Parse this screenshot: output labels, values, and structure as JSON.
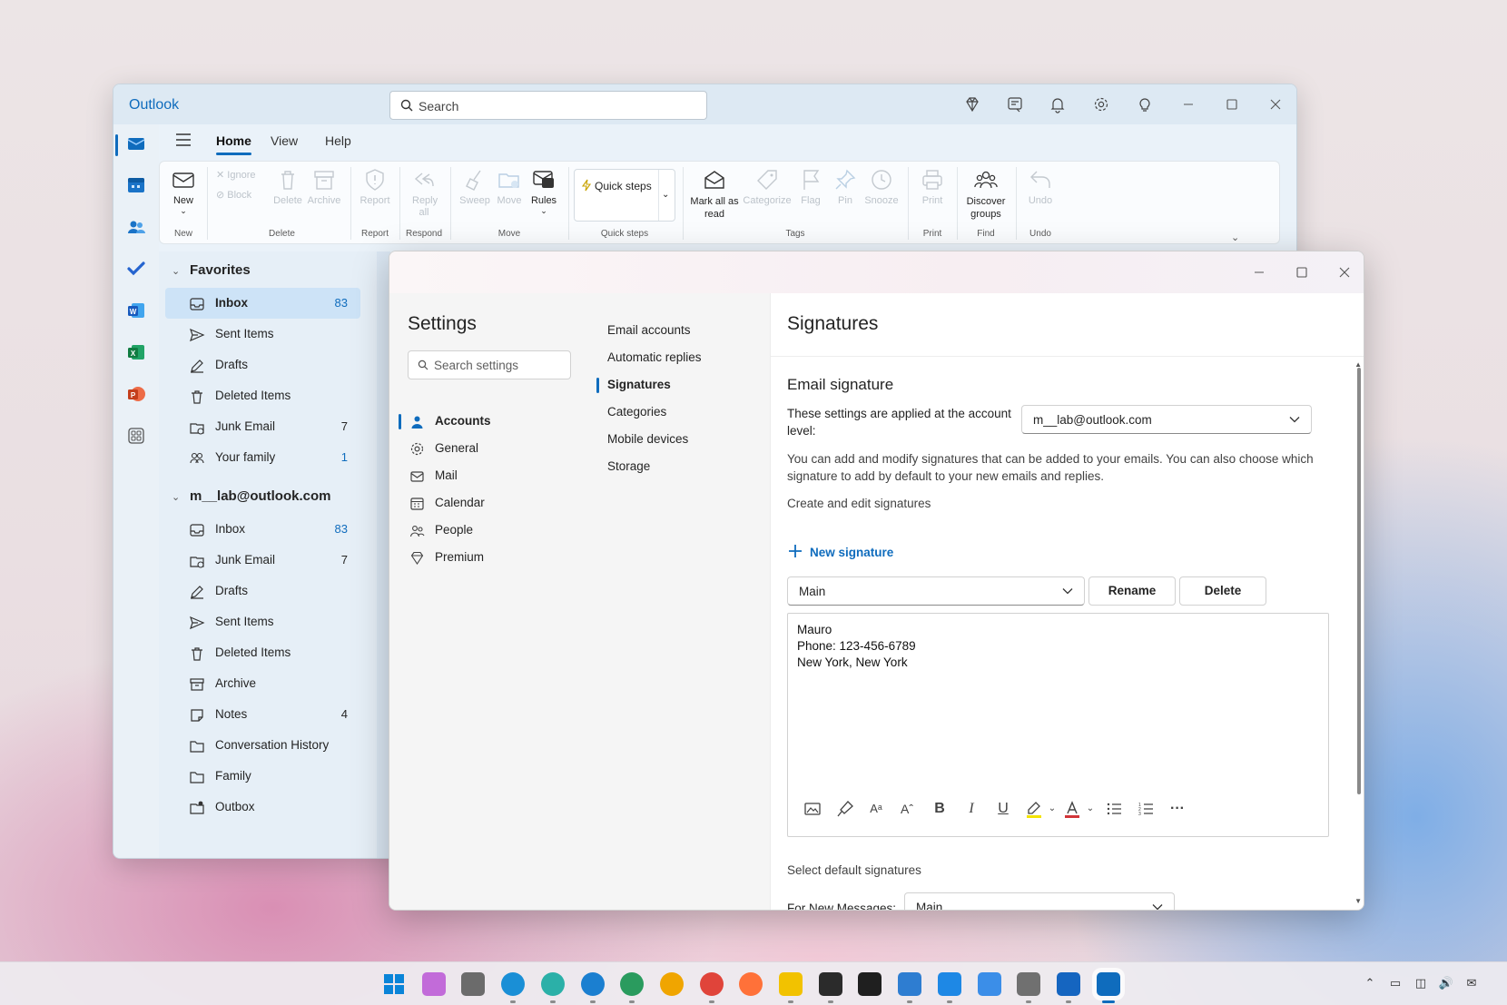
{
  "app": {
    "title": "Outlook",
    "search_placeholder": "Search",
    "accent": "#0f6cbd"
  },
  "titlebar_icons": [
    "diamond-icon",
    "notes-icon",
    "bell-icon",
    "gear-icon",
    "lightbulb-icon",
    "minimize-icon",
    "maximize-icon",
    "close-icon"
  ],
  "rail_icons": [
    "mail-icon",
    "calendar-icon",
    "people-icon",
    "todo-icon",
    "word-icon",
    "excel-icon",
    "powerpoint-icon",
    "apps-icon"
  ],
  "ribbon": {
    "tabs": [
      "Home",
      "View",
      "Help"
    ],
    "buttons": {
      "new": "New",
      "ignore": "Ignore",
      "block": "Block",
      "delete": "Delete",
      "archive": "Archive",
      "report": "Report",
      "reply_all": "Reply all",
      "sweep": "Sweep",
      "move": "Move",
      "rules": "Rules",
      "quick_steps": "Quick steps",
      "mark_all_read": "Mark all as read",
      "categorize": "Categorize",
      "flag": "Flag",
      "pin": "Pin",
      "snooze": "Snooze",
      "print": "Print",
      "discover_groups": "Discover groups",
      "undo": "Undo"
    },
    "groups": {
      "new": "New",
      "delete": "Delete",
      "report": "Report",
      "respond": "Respond",
      "move": "Move",
      "quick_steps": "Quick steps",
      "tags": "Tags",
      "print": "Print",
      "find": "Find",
      "undo": "Undo"
    }
  },
  "folders": {
    "favorites_label": "Favorites",
    "favorites": [
      {
        "name": "Inbox",
        "count": "83",
        "icon": "inbox-icon"
      },
      {
        "name": "Sent Items",
        "count": "",
        "icon": "send-icon"
      },
      {
        "name": "Drafts",
        "count": "",
        "icon": "drafts-icon"
      },
      {
        "name": "Deleted Items",
        "count": "",
        "icon": "trash-icon"
      },
      {
        "name": "Junk Email",
        "count": "7",
        "icon": "junk-icon"
      },
      {
        "name": "Your family",
        "count": "1",
        "icon": "family-icon"
      }
    ],
    "account_label": "m__lab@outlook.com",
    "account": [
      {
        "name": "Inbox",
        "count": "83",
        "icon": "inbox-icon"
      },
      {
        "name": "Junk Email",
        "count": "7",
        "icon": "junk-icon"
      },
      {
        "name": "Drafts",
        "count": "",
        "icon": "drafts-icon"
      },
      {
        "name": "Sent Items",
        "count": "",
        "icon": "send-icon"
      },
      {
        "name": "Deleted Items",
        "count": "",
        "icon": "trash-icon"
      },
      {
        "name": "Archive",
        "count": "",
        "icon": "archive-icon"
      },
      {
        "name": "Notes",
        "count": "4",
        "icon": "note-icon"
      },
      {
        "name": "Conversation History",
        "count": "",
        "icon": "folder-icon"
      },
      {
        "name": "Family",
        "count": "",
        "icon": "folder-icon"
      },
      {
        "name": "Outbox",
        "count": "",
        "icon": "outbox-icon"
      }
    ]
  },
  "settings": {
    "title": "Settings",
    "search_placeholder": "Search settings",
    "nav": [
      {
        "label": "Accounts",
        "icon": "person-icon",
        "active": true
      },
      {
        "label": "General",
        "icon": "gear-icon",
        "active": false
      },
      {
        "label": "Mail",
        "icon": "mail-icon",
        "active": false
      },
      {
        "label": "Calendar",
        "icon": "calendar-icon",
        "active": false
      },
      {
        "label": "People",
        "icon": "people-icon",
        "active": false
      },
      {
        "label": "Premium",
        "icon": "diamond-icon",
        "active": false
      }
    ],
    "subnav": [
      {
        "label": "Email accounts",
        "active": false
      },
      {
        "label": "Automatic replies",
        "active": false
      },
      {
        "label": "Signatures",
        "active": true
      },
      {
        "label": "Categories",
        "active": false
      },
      {
        "label": "Mobile devices",
        "active": false
      },
      {
        "label": "Storage",
        "active": false
      }
    ]
  },
  "signatures": {
    "title": "Signatures",
    "section_title": "Email signature",
    "account_note": "These settings are applied at the account level:",
    "account_value": "m__lab@outlook.com",
    "description": "You can add and modify signatures that can be added to your emails. You can also choose which signature to add by default to your new emails and replies.",
    "create_label": "Create and edit signatures",
    "new_signature": "New signature",
    "selected_signature": "Main",
    "rename": "Rename",
    "delete": "Delete",
    "signature_lines": [
      "Mauro",
      "Phone: 123-456-6789",
      "New York, New York"
    ],
    "editor_tools": [
      "image-icon",
      "format-painter-icon",
      "font-size-icon",
      "grow-font-icon",
      "bold-icon",
      "italic-icon",
      "underline-icon",
      "highlight-icon",
      "font-color-icon",
      "bullets-icon",
      "numbering-icon",
      "more-icon"
    ],
    "default_label": "Select default signatures",
    "for_new_label": "For New Messages:",
    "for_new_value": "Main"
  },
  "taskbar_icons": [
    "start-icon",
    "copilot-icon",
    "settings-icon",
    "edge-icon",
    "edge-canary-icon",
    "edge-beta-icon",
    "edge-dev-icon",
    "chrome-canary-icon",
    "chrome-icon",
    "firefox-icon",
    "file-explorer-icon",
    "terminal-icon",
    "chatgpt-icon",
    "notepad-icon",
    "photos-icon",
    "paint-icon",
    "clock-icon",
    "remote-desktop-icon",
    "outlook-icon"
  ],
  "tray_icons": [
    "chevron-up-icon",
    "display-icon",
    "network-icon",
    "volume-icon",
    "notification-icon"
  ]
}
